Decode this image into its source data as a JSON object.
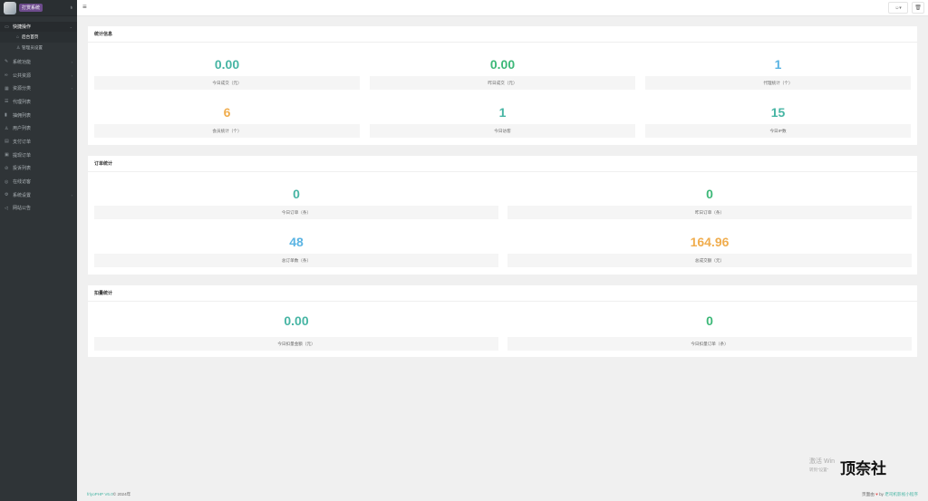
{
  "sidebar": {
    "brand": "打赏系统",
    "group": "快捷操作",
    "subs": [
      {
        "label": "后台首页",
        "icon": "home-icon"
      },
      {
        "label": "管理员设置",
        "icon": "user-icon"
      }
    ],
    "items": [
      {
        "label": "系统功能",
        "icon": "wrench-icon",
        "arrow": true
      },
      {
        "label": "公共资源",
        "icon": "link-icon",
        "arrow": true
      },
      {
        "label": "资源分类",
        "icon": "grid-icon",
        "arrow": true
      },
      {
        "label": "代理列表",
        "icon": "list-icon",
        "arrow": false
      },
      {
        "label": "抽佣列表",
        "icon": "chart-icon",
        "arrow": false
      },
      {
        "label": "用户列表",
        "icon": "user-icon",
        "arrow": false
      },
      {
        "label": "支付订单",
        "icon": "card-icon",
        "arrow": false
      },
      {
        "label": "提现订单",
        "icon": "wallet-icon",
        "arrow": false
      },
      {
        "label": "投诉列表",
        "icon": "alert-icon",
        "arrow": false
      },
      {
        "label": "在线访客",
        "icon": "globe-icon",
        "arrow": false
      },
      {
        "label": "系统设置",
        "icon": "gear-icon",
        "arrow": true
      },
      {
        "label": "网站公告",
        "icon": "megaphone-icon",
        "arrow": false
      }
    ]
  },
  "panels": {
    "stats": {
      "title": "统计信息",
      "cards": [
        {
          "value": "0.00",
          "label": "今日成交（元）",
          "color": "#47b5a4"
        },
        {
          "value": "0.00",
          "label": "昨日成交（元）",
          "color": "#3cb878"
        },
        {
          "value": "1",
          "label": "代理统计（个）",
          "color": "#5bb4e3"
        },
        {
          "value": "6",
          "label": "会员统计（个）",
          "color": "#f0ad4e"
        },
        {
          "value": "1",
          "label": "今日访客",
          "color": "#47b5a4"
        },
        {
          "value": "15",
          "label": "今日IP数",
          "color": "#47b5a4"
        }
      ]
    },
    "orders": {
      "title": "订单统计",
      "cards": [
        {
          "value": "0",
          "label": "今日订单（条）",
          "color": "#47b5a4"
        },
        {
          "value": "0",
          "label": "昨日订单（条）",
          "color": "#3cb878"
        },
        {
          "value": "48",
          "label": "总订单数（条）",
          "color": "#5bb4e3"
        },
        {
          "value": "164.96",
          "label": "总成交额（元）",
          "color": "#f0ad4e"
        }
      ]
    },
    "deduct": {
      "title": "扣量统计",
      "cards": [
        {
          "value": "0.00",
          "label": "今日扣量金额（元）",
          "color": "#47b5a4"
        },
        {
          "value": "0",
          "label": "今日扣量订单（条）",
          "color": "#3cb878"
        }
      ]
    }
  },
  "footer": {
    "left_brand": "frlyoPHP V6.0",
    "left_rest": " © 2024年",
    "right_prefix": "页面由",
    "right_by": "by",
    "right_brand": "老司机影视小程序"
  },
  "watermark": {
    "line1": "激活 Win",
    "line2": "转到\"设置\"",
    "stamp": "顶奈社"
  }
}
